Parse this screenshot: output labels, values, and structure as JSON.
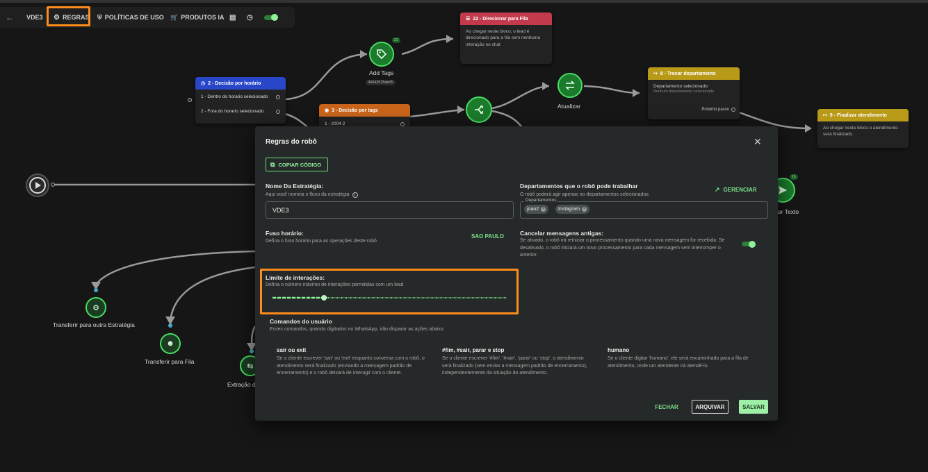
{
  "toolbar": {
    "back_icon": "arrow-left-icon",
    "strategy": "VDE3",
    "rules": "REGRAS",
    "policies": "POLÍTICAS DE USO",
    "products": "PRODUTOS IA",
    "highlight_color": "#ff8c1a"
  },
  "nodes": {
    "direct_queue": {
      "title": "22 - Direcionar para Fila",
      "body": "Ao chegar neste bloco, o lead é direcionado para a fila sem nenhuma interação no chat"
    },
    "add_tags": {
      "label": "Add Tags",
      "code": "04042025de05",
      "badge": "21"
    },
    "decision_time": {
      "title": "2 - Decisão por horário",
      "opt1": "1 - Dentro do horario selecionado",
      "opt2": "2 - Fora do horario selecionado"
    },
    "decision_tag": {
      "title": "3 - Decisão por tags",
      "opt1": "1 - 2004 2"
    },
    "update": {
      "label": "Atualizar"
    },
    "change_dept": {
      "title": "8 - Trocar departamento",
      "field": "Departamento selecionado:",
      "value": "Nenhum departamento selecionado",
      "next": "Próximo passo"
    },
    "finish": {
      "title": "9 - Finalizar atendimento",
      "body": "Ao chegar neste bloco o atendimento será finalizado."
    },
    "send_text": {
      "label": "ar Texto",
      "badge": "15"
    },
    "transfer_strategy": {
      "label": "Transferir para outra Estratégia"
    },
    "transfer_queue": {
      "label": "Transferir para Fila"
    },
    "extract": {
      "label": "Extração d"
    }
  },
  "modal": {
    "title": "Regras do robô",
    "copy_code": "COPIAR CÓDIGO",
    "strategy_name": {
      "label": "Nome Da Estratégia:",
      "help": "Aqui você nomeia o fluxo da estratégia",
      "value": "VDE3"
    },
    "departments": {
      "label": "Departamentos que o robô pode trabalhar",
      "help": "O robô poderá agir apenas no departamentos selecionados",
      "manage": "GERENCIAR",
      "legend": "Departamentos",
      "chips": [
        "joao2",
        "Instagram"
      ]
    },
    "timezone": {
      "label": "Fuso horário:",
      "help": "Defina o fuso horário para as operações deste robô",
      "value": "SAO PAULO"
    },
    "cancel_old": {
      "label": "Cancelar mensagens antigas:",
      "help": "Se ativado, o robô irá reiniciar o processamento quando uma nova mensagem for recebida. Se desativado, o robô iniciará um novo processamento para cada mensagem sem interromper o anterior.",
      "enabled": true
    },
    "interaction_limit": {
      "label": "Limite de interações:",
      "help": "Defina o número máximo de interações permitidas com um lead",
      "value_fraction": 0.22
    },
    "commands": {
      "title": "Comandos do usuário",
      "help": "Esses comandos, quando digitados no WhatsApp, irão disparar as ações abaixo.",
      "items": [
        {
          "name": "sair ou exit",
          "text": "Se o cliente escrever 'sair' ou 'exit' enquanto conversa com o robô, o atendimento será finalizado (enviando a mensagem padrão de encerramento) e o robô deixará de interagir com o cliente."
        },
        {
          "name": "#fim, #sair, parar e stop",
          "text": "Se o cliente escrever '#fim', '#sair', 'parar' ou 'stop', o atendimento será finalizado (sem enviar a mensagem padrão de encerramento), independentemente da situação do atendimento."
        },
        {
          "name": "humano",
          "text": "Se o cliente digitar 'humano', ele será encaminhado para a fila de atendimento, onde um atendente irá atendê-lo."
        }
      ]
    },
    "buttons": {
      "close": "FECHAR",
      "archive": "ARQUIVAR",
      "save": "SALVAR"
    }
  }
}
